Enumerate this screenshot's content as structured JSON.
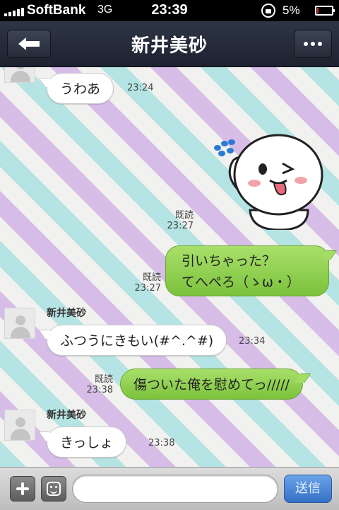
{
  "status_bar": {
    "carrier": "SoftBank",
    "network": "3G",
    "time": "23:39",
    "battery_text": "5%",
    "battery_level": 0.05
  },
  "nav": {
    "title": "新井美砂"
  },
  "messages": [
    {
      "id": "m1",
      "direction": "in",
      "text": "うわあ",
      "time": "23:24"
    },
    {
      "id": "m2",
      "direction": "out",
      "type": "sticker",
      "read": "既読",
      "time": "23:27"
    },
    {
      "id": "m3",
      "direction": "out",
      "line1": "引いちゃった？",
      "line2": "てへぺろ（ゝω・）",
      "read": "既読",
      "time": "23:27"
    },
    {
      "id": "m4",
      "direction": "in",
      "sender": "新井美砂",
      "text": "ふつうにきもい(#^.^#)",
      "time": "23:34"
    },
    {
      "id": "m5",
      "direction": "out",
      "text": "傷ついた俺を慰めてっ/////",
      "read": "既読",
      "time": "23:38"
    },
    {
      "id": "m6",
      "direction": "in",
      "sender": "新井美砂",
      "text": "きっしょ",
      "time": "23:38"
    }
  ],
  "input_bar": {
    "send_label": "送信",
    "placeholder": ""
  },
  "colors": {
    "nav_bg": "#262b38",
    "bubble_out": "#8fd14f",
    "bubble_in": "#ffffff",
    "send_button": "#3f7fd4",
    "stripe_teal": "#aae1e1",
    "stripe_purple": "#d2b4e6"
  },
  "icons": {
    "back": "back-arrow-icon",
    "menu": "more-dots-icon",
    "plus": "plus-icon",
    "emoji": "emoji-icon",
    "avatar": "default-avatar-icon"
  }
}
